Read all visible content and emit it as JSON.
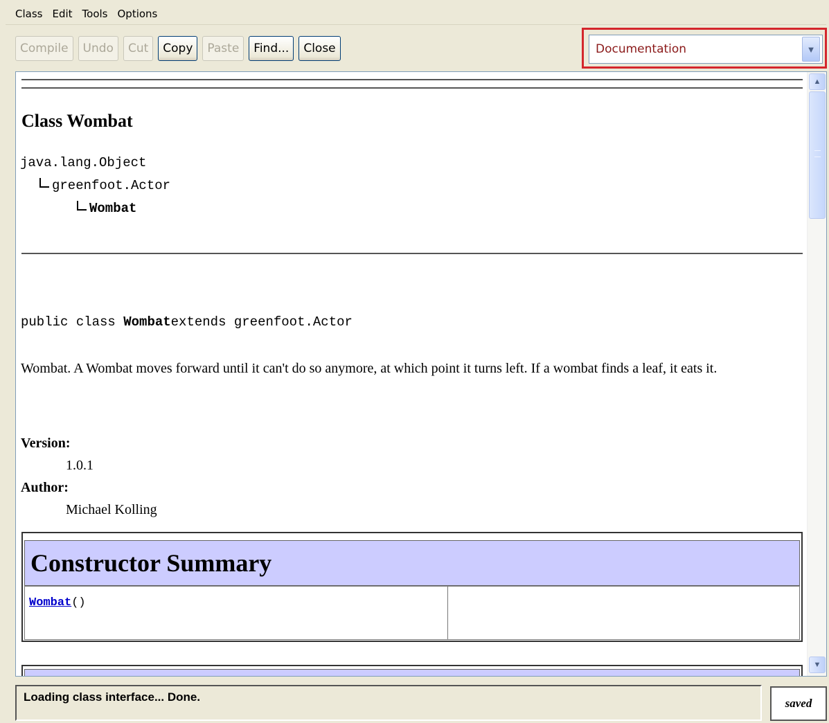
{
  "menu": [
    "Class",
    "Edit",
    "Tools",
    "Options"
  ],
  "toolbar": {
    "compile": "Compile",
    "undo": "Undo",
    "cut": "Cut",
    "copy": "Copy",
    "paste": "Paste",
    "find": "Find...",
    "close": "Close"
  },
  "view_selector": {
    "value": "Documentation",
    "arrow_icon": "chevron-down-icon"
  },
  "doc": {
    "class_title": "Class Wombat",
    "hierarchy": [
      "java.lang.Object",
      "greenfoot.Actor",
      "Wombat"
    ],
    "declaration": {
      "prefix": "public class ",
      "name": "Wombat",
      "suffix": "extends greenfoot.Actor"
    },
    "description": "Wombat. A Wombat moves forward until it can't do so anymore, at which point it turns left. If a wombat finds a leaf, it eats it.",
    "version_label": "Version:",
    "version": "1.0.1",
    "author_label": "Author:",
    "author": "Michael Kolling",
    "constructor_summary": {
      "title": "Constructor Summary",
      "ctor_name": "Wombat",
      "ctor_args": "()"
    }
  },
  "status": {
    "message": "Loading class interface... Done.",
    "saved": "saved"
  },
  "colors": {
    "selector_highlight": "#d4262c",
    "summary_header": "#ccccff",
    "link": "#0000cc"
  }
}
